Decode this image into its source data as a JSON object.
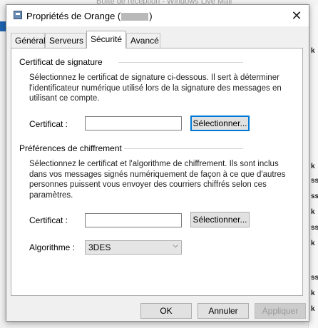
{
  "background": {
    "title": "Boîte de réception - Windows Live Mail",
    "right_glyphs": [
      "k",
      "k",
      "ss",
      "ss",
      "k",
      "ss",
      "k",
      "ss",
      "k",
      "k"
    ]
  },
  "dialog": {
    "title_prefix": "Propriétés de Orange (",
    "title_suffix": ")",
    "close_glyph": "✕"
  },
  "tabs": [
    {
      "label": "Général",
      "active": false
    },
    {
      "label": "Serveurs",
      "active": false
    },
    {
      "label": "Sécurité",
      "active": true
    },
    {
      "label": "Avancé",
      "active": false
    }
  ],
  "signing": {
    "heading": "Certificat de signature",
    "description": "Sélectionnez le certificat de signature ci-dessous. Il sert à déterminer l'identificateur numérique utilisé lors de la signature des messages en utilisant ce compte.",
    "certificate_label": "Certificat :",
    "certificate_value": "",
    "select_button": "Sélectionner..."
  },
  "encryption": {
    "heading": "Préférences de chiffrement",
    "description": "Sélectionnez le certificat et l'algorithme de chiffrement. Ils sont inclus dans vos messages signés numériquement de façon à ce que d'autres personnes puissent vous envoyer des courriers chiffrés selon ces paramètres.",
    "certificate_label": "Certificat :",
    "certificate_value": "",
    "select_button": "Sélectionner...",
    "algorithm_label": "Algorithme :",
    "algorithm_value": "3DES",
    "chevron_glyph": "⌵"
  },
  "footer": {
    "ok": "OK",
    "cancel": "Annuler",
    "apply": "Appliquer"
  },
  "colors": {
    "focus_border": "#0078d7",
    "dialog_bg": "#f0f0f0"
  }
}
